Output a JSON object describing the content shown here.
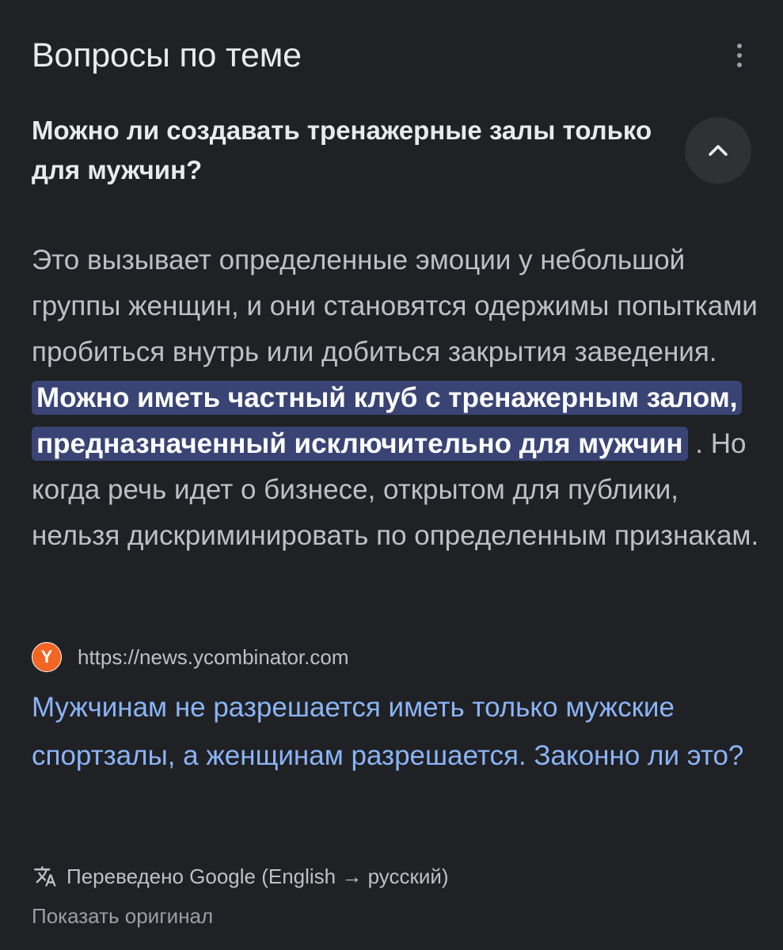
{
  "header": {
    "title": "Вопросы по теме",
    "more_icon": "more-vert-icon"
  },
  "question": {
    "text": "Можно ли создавать тренажерные залы только для мужчин?",
    "toggle_icon": "chevron-up-icon"
  },
  "answer": {
    "before_highlight": "Это вызывает определенные эмоции у небольшой группы женщин, и они становятся одержимы попытками пробиться внутрь или добиться закрытия заведения.",
    "highlight": "Можно иметь частный клуб с тренажерным залом, предназначенный исключительно для мужчин",
    "after_highlight": ". Но когда речь идет о бизнесе, открытом для публики, нельзя дискриминировать по определенным признакам."
  },
  "source": {
    "favicon_letter": "Y",
    "favicon_color": "#f26522",
    "url": "https://news.ycombinator.com",
    "title": "Мужчинам не разрешается иметь только мужские спортзалы, а женщинам разрешается. Законно ли это?"
  },
  "translation": {
    "icon": "translate-icon",
    "note": "Переведено Google (English → русский)",
    "show_original": "Показать оригинал"
  },
  "colors": {
    "background": "#202124",
    "text_primary": "#e8eaed",
    "text_secondary": "#bdc1c6",
    "link": "#8ab4f8",
    "highlight_bg": "#394475"
  }
}
